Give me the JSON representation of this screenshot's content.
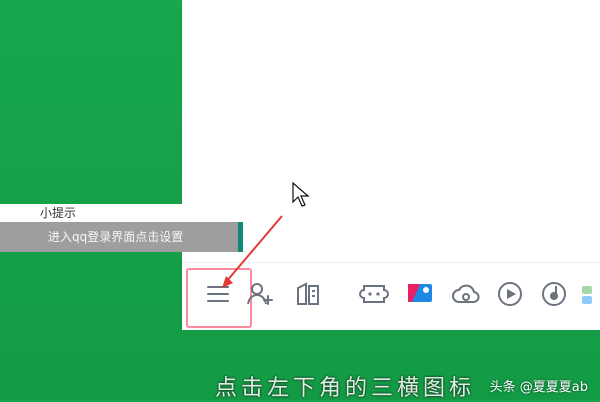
{
  "tooltip": {
    "title": "小提示",
    "message": "进入qq登录界面点击设置"
  },
  "toolbar": {
    "items": [
      {
        "name": "menu-icon"
      },
      {
        "name": "add-friend-icon"
      },
      {
        "name": "apps-icon"
      },
      {
        "name": "game-icon"
      },
      {
        "name": "monitor-icon"
      },
      {
        "name": "cloud-icon"
      },
      {
        "name": "video-play-icon"
      },
      {
        "name": "music-icon"
      },
      {
        "name": "more-icon"
      }
    ]
  },
  "caption": "点击左下角的三横图标",
  "watermark": "头条 @夏夏夏ab",
  "colors": {
    "background": "#16a34a",
    "highlight": "#ff8a9b",
    "arrow": "#e53935",
    "tooltip_accent": "#0e8a78"
  }
}
